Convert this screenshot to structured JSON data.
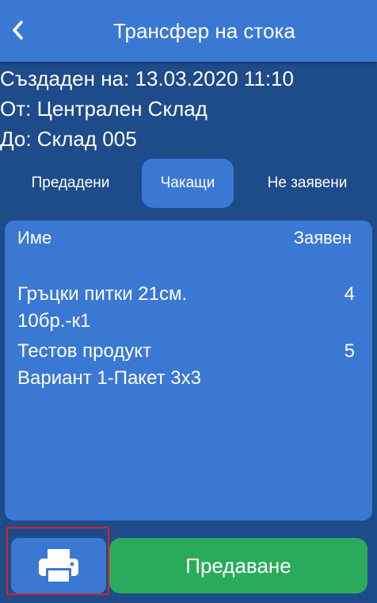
{
  "header": {
    "title": "Трансфер на стока",
    "back_icon": "chevron-left-icon"
  },
  "info": {
    "created": "Създаден на: 13.03.2020 11:10",
    "from": "От: Централен Склад",
    "to": "До: Склад 005"
  },
  "tabs": [
    {
      "label": "Предадени",
      "active": false
    },
    {
      "label": "Чакащи",
      "active": true
    },
    {
      "label": "Не заявени",
      "active": false
    }
  ],
  "table": {
    "columns": {
      "name": "Име",
      "requested": "Заявен"
    },
    "rows": [
      {
        "name_line1": "Гръцки питки 21см.",
        "name_line2": "10бр.-к1",
        "qty": "4"
      },
      {
        "name_line1": "Тестов продукт",
        "name_line2": "Вариант 1-Пакет 3x3",
        "qty": "5"
      }
    ]
  },
  "footer": {
    "print_icon": "printer-icon",
    "submit_label": "Предаване"
  },
  "colors": {
    "background": "#1e4b8a",
    "primary": "#3a78d4",
    "success": "#2aab5c",
    "highlight": "#d62028"
  }
}
